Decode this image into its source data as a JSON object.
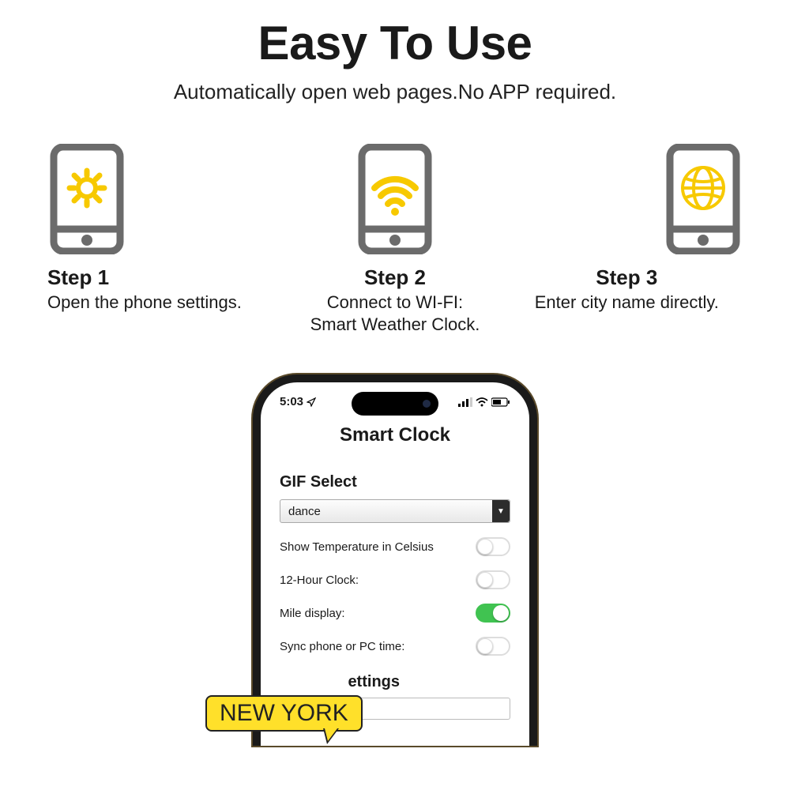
{
  "header": {
    "title": "Easy To Use",
    "subtitle": "Automatically open web pages.No APP required."
  },
  "steps": [
    {
      "title": "Step 1",
      "desc": "Open the phone settings."
    },
    {
      "title": "Step 2",
      "desc": "Connect to WI-FI:\nSmart Weather Clock."
    },
    {
      "title": "Step 3",
      "desc": "Enter city name directly."
    }
  ],
  "phone": {
    "status_time": "5:03",
    "app_title": "Smart Clock",
    "gif_section": "GIF Select",
    "gif_value": "dance",
    "settings": [
      {
        "label": "Show Temperature in Celsius",
        "on": false
      },
      {
        "label": "12-Hour Clock:",
        "on": false
      },
      {
        "label": "Mile display:",
        "on": true
      },
      {
        "label": "Sync phone or PC time:",
        "on": false
      }
    ],
    "partial_heading": "ettings",
    "city_value": "New York"
  },
  "callout": "NEW YORK",
  "colors": {
    "accent": "#f7c900",
    "outline": "#6b6b6b"
  }
}
